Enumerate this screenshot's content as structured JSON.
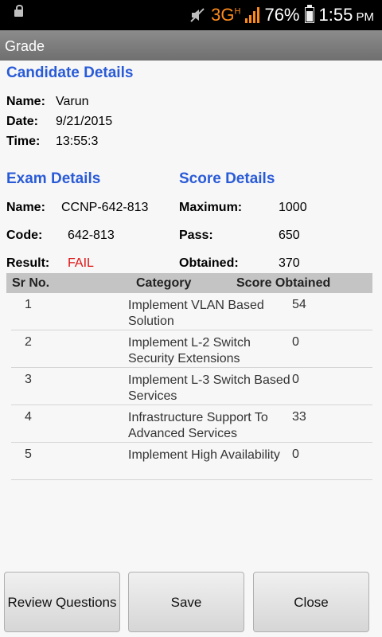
{
  "status_bar": {
    "network": "3G",
    "network_sup": "H",
    "battery": "76%",
    "time": "1:55",
    "ampm": "PM",
    "icons": [
      "lock-icon",
      "mute-icon",
      "signal-icon",
      "battery-icon"
    ]
  },
  "title": "Grade",
  "candidate": {
    "heading": "Candidate Details",
    "name_label": "Name:",
    "name": "Varun",
    "date_label": "Date:",
    "date": "9/21/2015",
    "time_label": "Time:",
    "time": "13:55:3"
  },
  "exam": {
    "heading": "Exam Details",
    "name_label": "Name:",
    "name": "CCNP-642-813",
    "code_label": "Code:",
    "code": "642-813",
    "result_label": "Result:",
    "result": "FAIL"
  },
  "score": {
    "heading": "Score Details",
    "maximum_label": "Maximum:",
    "maximum": "1000",
    "pass_label": "Pass:",
    "pass": "650",
    "obtained_label": "Obtained:",
    "obtained": "370"
  },
  "table": {
    "headers": [
      "Sr No.",
      "Category",
      "Score Obtained"
    ],
    "rows": [
      {
        "sr": "1",
        "category": "Implement VLAN Based Solution",
        "score": "54"
      },
      {
        "sr": "2",
        "category": "Implement L-2 Switch Security Extensions",
        "score": "0"
      },
      {
        "sr": "3",
        "category": "Implement L-3 Switch Based Services",
        "score": "0"
      },
      {
        "sr": "4",
        "category": "Infrastructure Support To Advanced Services",
        "score": "33"
      },
      {
        "sr": "5",
        "category": "Implement High Availability",
        "score": "0"
      }
    ]
  },
  "buttons": {
    "review": "Review Questions",
    "save": "Save",
    "close": "Close"
  },
  "colors": {
    "heading": "#2a5bd7",
    "fail": "#e01010",
    "network": "#ff8a1c"
  }
}
